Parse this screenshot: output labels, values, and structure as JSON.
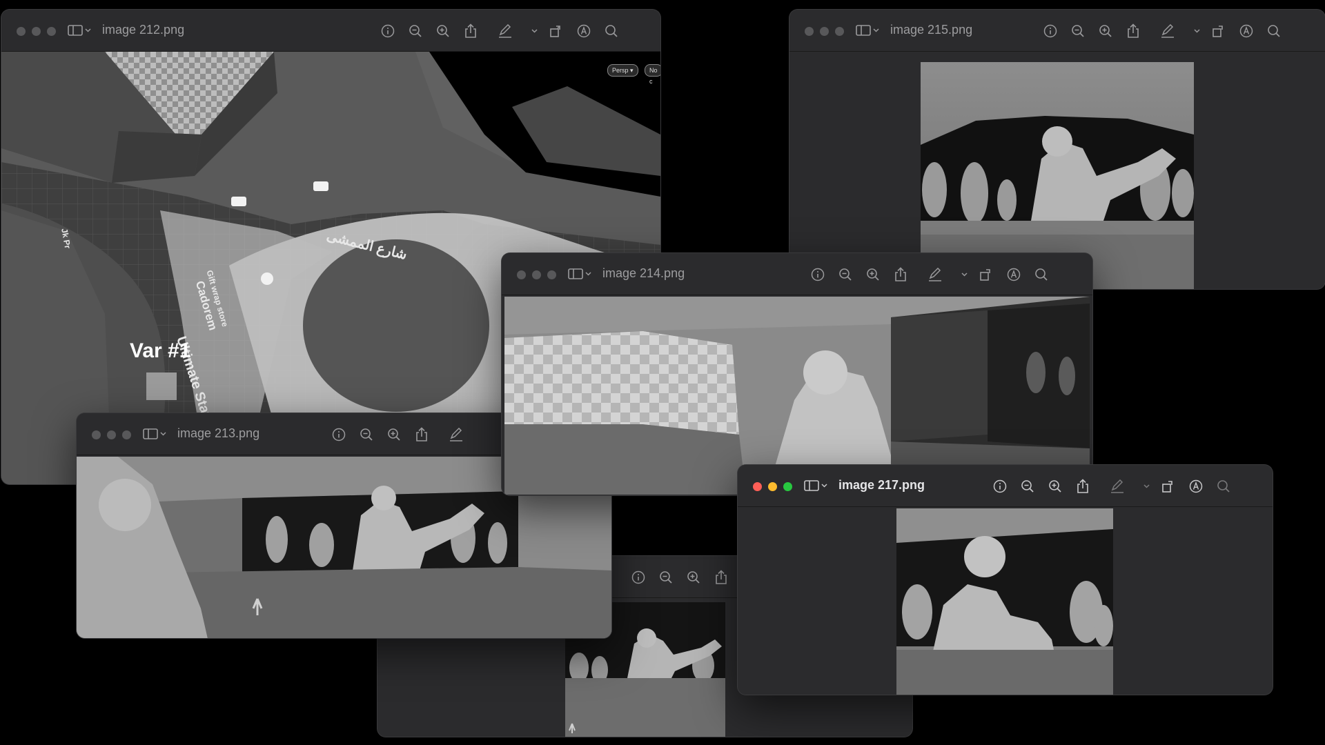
{
  "windows": {
    "w212": {
      "title": "image 212.png"
    },
    "w215": {
      "title": "image 215.png"
    },
    "w214": {
      "title": "image 214.png"
    },
    "w213": {
      "title": "image 213.png"
    },
    "w216": {
      "title": ""
    },
    "w217": {
      "title": "image 217.png"
    }
  },
  "map": {
    "variant_label": "Var #1",
    "street_arabic": "شارع الممشى",
    "store_name": "Cadorem",
    "store_subtitle": "Gift wrap store",
    "side_street": "Ultimate Stay",
    "corner_label": "Jk Pr",
    "persp_badge": "Persp ▾",
    "nocam_badge": "No c"
  },
  "colors": {
    "traffic_red": "#ff5f57",
    "traffic_yellow": "#febc2e",
    "traffic_green": "#28c840",
    "inactive_light": "#58585a",
    "window_bg": "#2b2b2d"
  }
}
